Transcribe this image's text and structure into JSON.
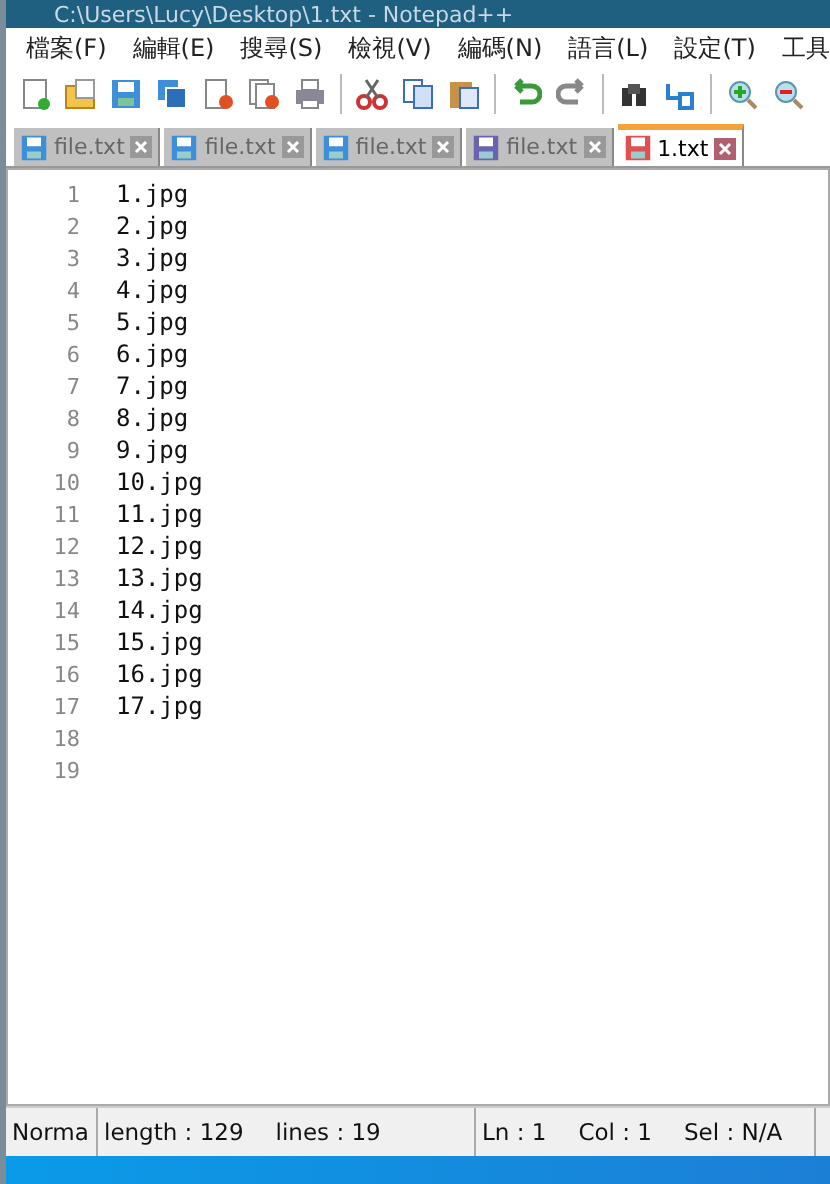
{
  "window": {
    "title": "C:\\Users\\Lucy\\Desktop\\1.txt - Notepad++"
  },
  "menu": [
    "檔案(F)",
    "編輯(E)",
    "搜尋(S)",
    "檢視(V)",
    "編碼(N)",
    "語言(L)",
    "設定(T)",
    "工具"
  ],
  "toolbar": [
    {
      "kind": "new"
    },
    {
      "kind": "open"
    },
    {
      "kind": "save"
    },
    {
      "kind": "saveall"
    },
    {
      "kind": "close"
    },
    {
      "kind": "closeall"
    },
    {
      "kind": "print"
    },
    {
      "kind": "sep"
    },
    {
      "kind": "cut"
    },
    {
      "kind": "copy"
    },
    {
      "kind": "paste"
    },
    {
      "kind": "sep"
    },
    {
      "kind": "undo"
    },
    {
      "kind": "redo"
    },
    {
      "kind": "sep"
    },
    {
      "kind": "find"
    },
    {
      "kind": "replace"
    },
    {
      "kind": "sep"
    },
    {
      "kind": "zoomin"
    },
    {
      "kind": "zoomout"
    }
  ],
  "tabs": [
    {
      "label": "file.txt",
      "selected": false,
      "color": "#3c8fd8"
    },
    {
      "label": "file.txt",
      "selected": false,
      "color": "#3c8fd8"
    },
    {
      "label": "file.txt",
      "selected": false,
      "color": "#3c8fd8"
    },
    {
      "label": "file.txt",
      "selected": false,
      "color": "#6a64b0"
    },
    {
      "label": "1.txt",
      "selected": true,
      "color": "#e05050"
    }
  ],
  "editor": {
    "lines": [
      {
        "number": "1",
        "text": "1.jpg"
      },
      {
        "number": "2",
        "text": "2.jpg"
      },
      {
        "number": "3",
        "text": "3.jpg"
      },
      {
        "number": "4",
        "text": "4.jpg"
      },
      {
        "number": "5",
        "text": "5.jpg"
      },
      {
        "number": "6",
        "text": "6.jpg"
      },
      {
        "number": "7",
        "text": "7.jpg"
      },
      {
        "number": "8",
        "text": "8.jpg"
      },
      {
        "number": "9",
        "text": "9.jpg"
      },
      {
        "number": "10",
        "text": "10.jpg"
      },
      {
        "number": "11",
        "text": "11.jpg"
      },
      {
        "number": "12",
        "text": "12.jpg"
      },
      {
        "number": "13",
        "text": "13.jpg"
      },
      {
        "number": "14",
        "text": "14.jpg"
      },
      {
        "number": "15",
        "text": "15.jpg"
      },
      {
        "number": "16",
        "text": "16.jpg"
      },
      {
        "number": "17",
        "text": "17.jpg"
      },
      {
        "number": "18"
      },
      {
        "number": "19"
      }
    ]
  },
  "status_bar": {
    "doc_type": "Norma",
    "length": "length : 129",
    "lines": "lines : 19",
    "ln": "Ln : 1",
    "col": "Col : 1",
    "sel": "Sel : N/A"
  }
}
